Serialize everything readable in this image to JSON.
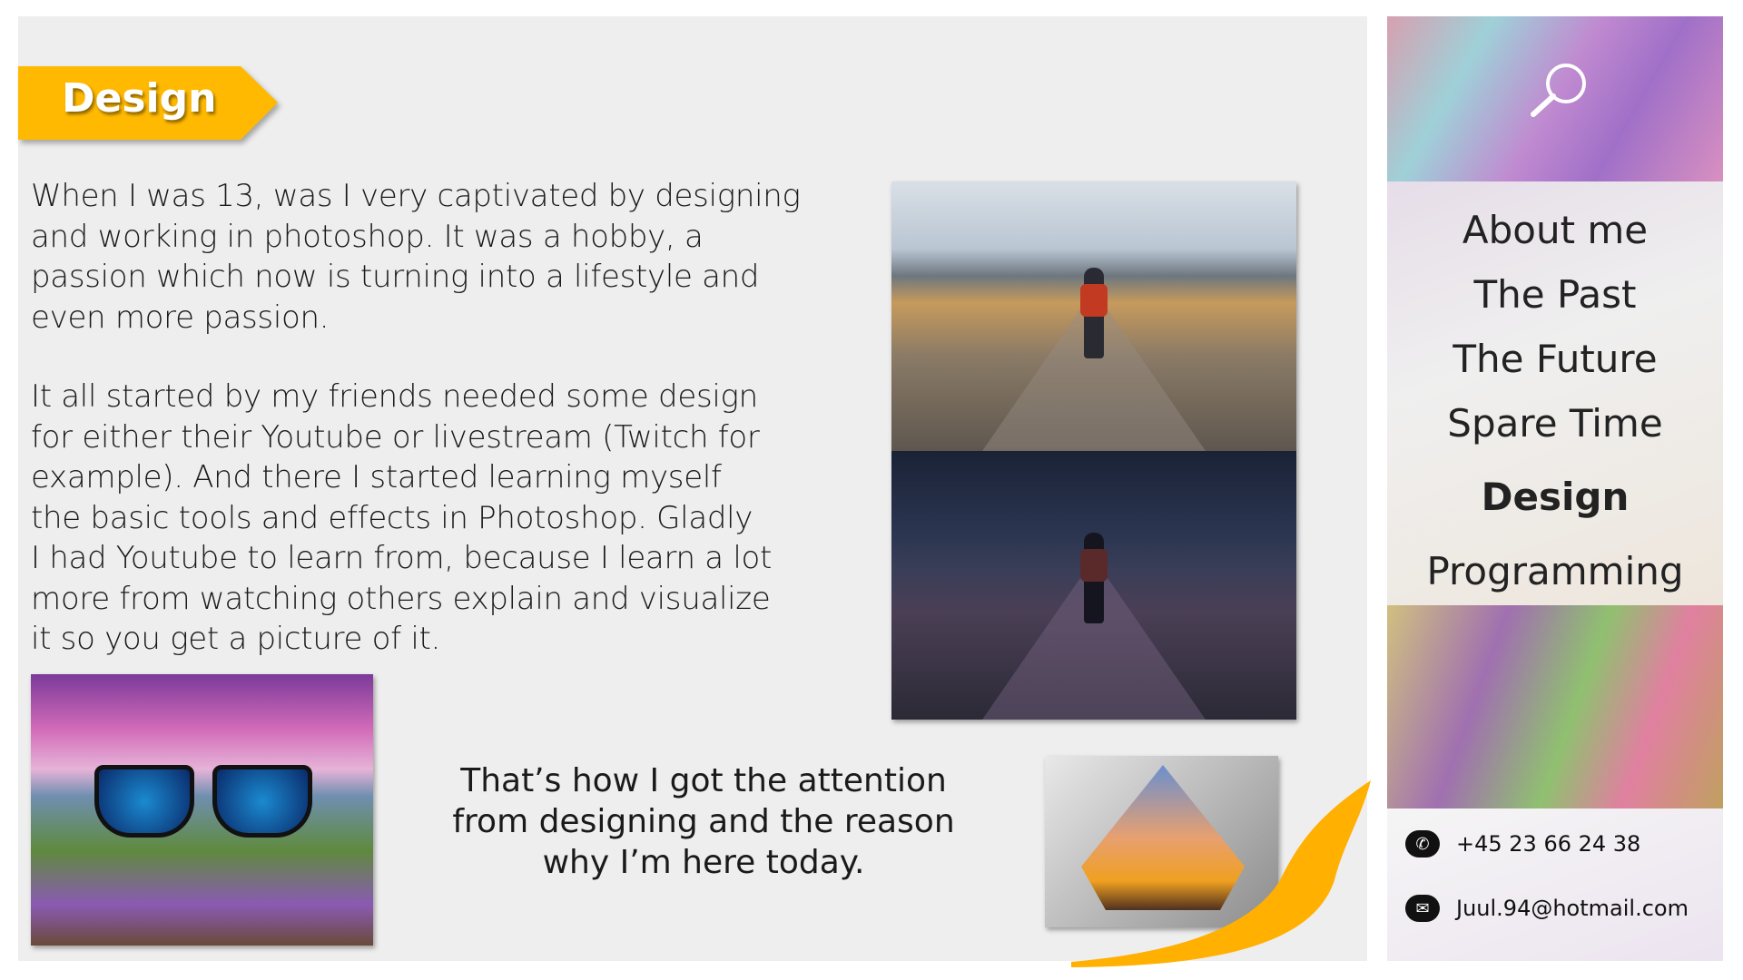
{
  "banner": {
    "title": "Design",
    "color": "#FFB900"
  },
  "content": {
    "paragraph1": "When I was 13, was I very captivated by designing\nand working in photoshop. It was a hobby, a\npassion which now is turning into a lifestyle and\neven more passion.",
    "paragraph2": "It all started by my friends needed some design\nfor either their Youtube or livestream (Twitch for\nexample). And there I started learning myself\nthe basic tools and effects in Photoshop. Gladly\nI had Youtube to learn from, because I learn a lot\nmore from watching others explain and visualize\nit so you get a picture of it.",
    "caption": "That’s how I got the attention\nfrom designing and the reason\nwhy I’m here today."
  },
  "sidebar": {
    "search_icon": "search-icon",
    "nav": [
      {
        "label": "About me"
      },
      {
        "label": "The Past"
      },
      {
        "label": "The Future"
      },
      {
        "label": "Spare Time"
      },
      {
        "label": "Design",
        "active": true
      },
      {
        "label": "Programming"
      }
    ],
    "contacts": {
      "phone": "+45 23 66 24 38",
      "email": "Juul.94@hotmail.com"
    }
  }
}
